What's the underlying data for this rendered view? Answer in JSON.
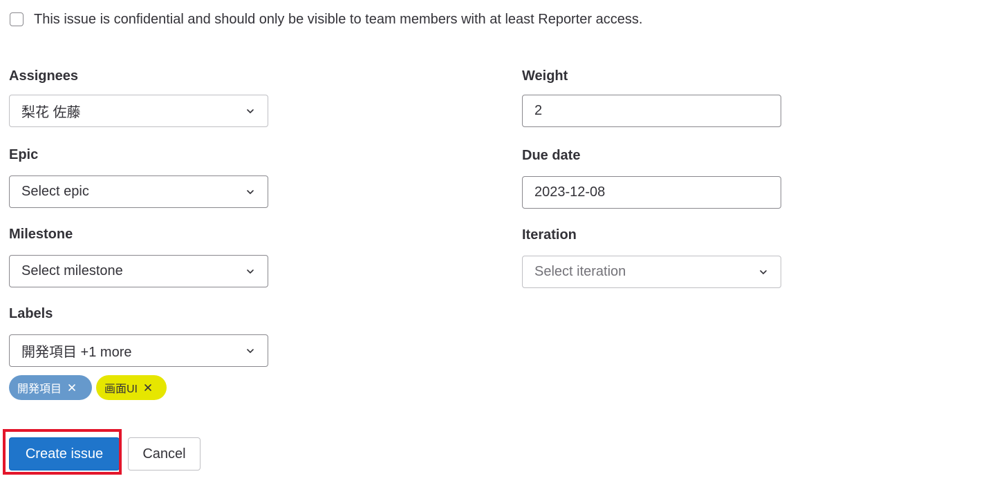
{
  "confidential": {
    "checked": false,
    "text": "This issue is confidential and should only be visible to team members with at least Reporter access."
  },
  "left_column": {
    "assignees": {
      "label": "Assignees",
      "value": "梨花 佐藤"
    },
    "epic": {
      "label": "Epic",
      "value": "Select epic"
    },
    "milestone": {
      "label": "Milestone",
      "value": "Select milestone"
    },
    "labels": {
      "label": "Labels",
      "value": "開発項目 +1 more"
    }
  },
  "right_column": {
    "weight": {
      "label": "Weight",
      "value": "2"
    },
    "due_date": {
      "label": "Due date",
      "value": "2023-12-08"
    },
    "iteration": {
      "label": "Iteration",
      "value": "Select iteration"
    }
  },
  "selected_labels": [
    {
      "text": "開発項目",
      "bg_color": "#6699cc",
      "text_color": "#ffffff"
    },
    {
      "text": "画面UI",
      "bg_color": "#e6e600",
      "text_color": "#333238"
    }
  ],
  "actions": {
    "create_label": "Create issue",
    "cancel_label": "Cancel"
  },
  "colors": {
    "primary": "#1f75cb",
    "highlight": "#e3162b"
  },
  "icons": {
    "dropdown": "chevron-down-icon",
    "remove_label": "close-icon"
  }
}
